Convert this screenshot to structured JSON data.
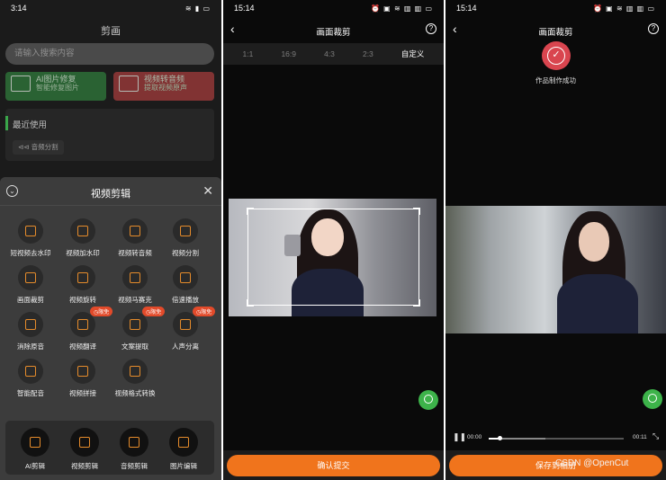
{
  "screen1": {
    "status": {
      "time": "3:14",
      "icons": "≋ ▮ ▭"
    },
    "app_title": "剪画",
    "search_placeholder": "请输入搜索内容",
    "promos": [
      {
        "title": "AI图片修复",
        "subtitle": "智能修复图片"
      },
      {
        "title": "视频转音频",
        "subtitle": "提取视频原声"
      }
    ],
    "recent": {
      "title": "最近使用",
      "chip": "⊲⊲ 音频分割"
    },
    "sheet": {
      "title": "视频剪辑",
      "collapse_glyph": "⌄",
      "close_glyph": "✕",
      "tools": [
        {
          "label": "短视频去水印"
        },
        {
          "label": "视频加水印"
        },
        {
          "label": "视频转音频"
        },
        {
          "label": "视频分割"
        },
        {
          "label": "画面裁剪"
        },
        {
          "label": "视频旋转"
        },
        {
          "label": "视频马赛克"
        },
        {
          "label": "倍速播放"
        },
        {
          "label": "消除原音"
        },
        {
          "label": "视频翻译",
          "badge": "◷限免"
        },
        {
          "label": "文案提取",
          "badge": "◷限免"
        },
        {
          "label": "人声分离",
          "badge": "◷限免"
        },
        {
          "label": "智能配音"
        },
        {
          "label": "视频拼接"
        },
        {
          "label": "视频格式转换"
        }
      ]
    },
    "dock": [
      {
        "label": "AI剪辑"
      },
      {
        "label": "视频剪辑"
      },
      {
        "label": "音频剪辑"
      },
      {
        "label": "图片编辑"
      }
    ]
  },
  "screen2": {
    "status": {
      "time": "15:14",
      "icons": "⏰ ▣ ≋ ▥ ▥ ▭"
    },
    "title": "画面裁剪",
    "back_glyph": "‹",
    "help_glyph": "?",
    "ratios": [
      "1:1",
      "16:9",
      "4:3",
      "2:3",
      "自定义"
    ],
    "active_ratio": "自定义",
    "confirm_button": "确认提交"
  },
  "screen3": {
    "status": {
      "time": "15:14",
      "icons": "⏰ ▣ ≋ ▥ ▥ ▭"
    },
    "title": "画面裁剪",
    "back_glyph": "‹",
    "help_glyph": "?",
    "success_glyph": "✓",
    "success_text": "作品制作成功",
    "player": {
      "current": "00:00",
      "duration": "00:11",
      "progress": 0.08,
      "buffered": 0.42
    },
    "save_button": "保存到相册",
    "watermark": "CSDN @OpenCut"
  },
  "colors": {
    "accent": "#f0741c",
    "tool_icon": "#e58b2b",
    "success": "#d9454f",
    "fab": "#3db34a"
  }
}
